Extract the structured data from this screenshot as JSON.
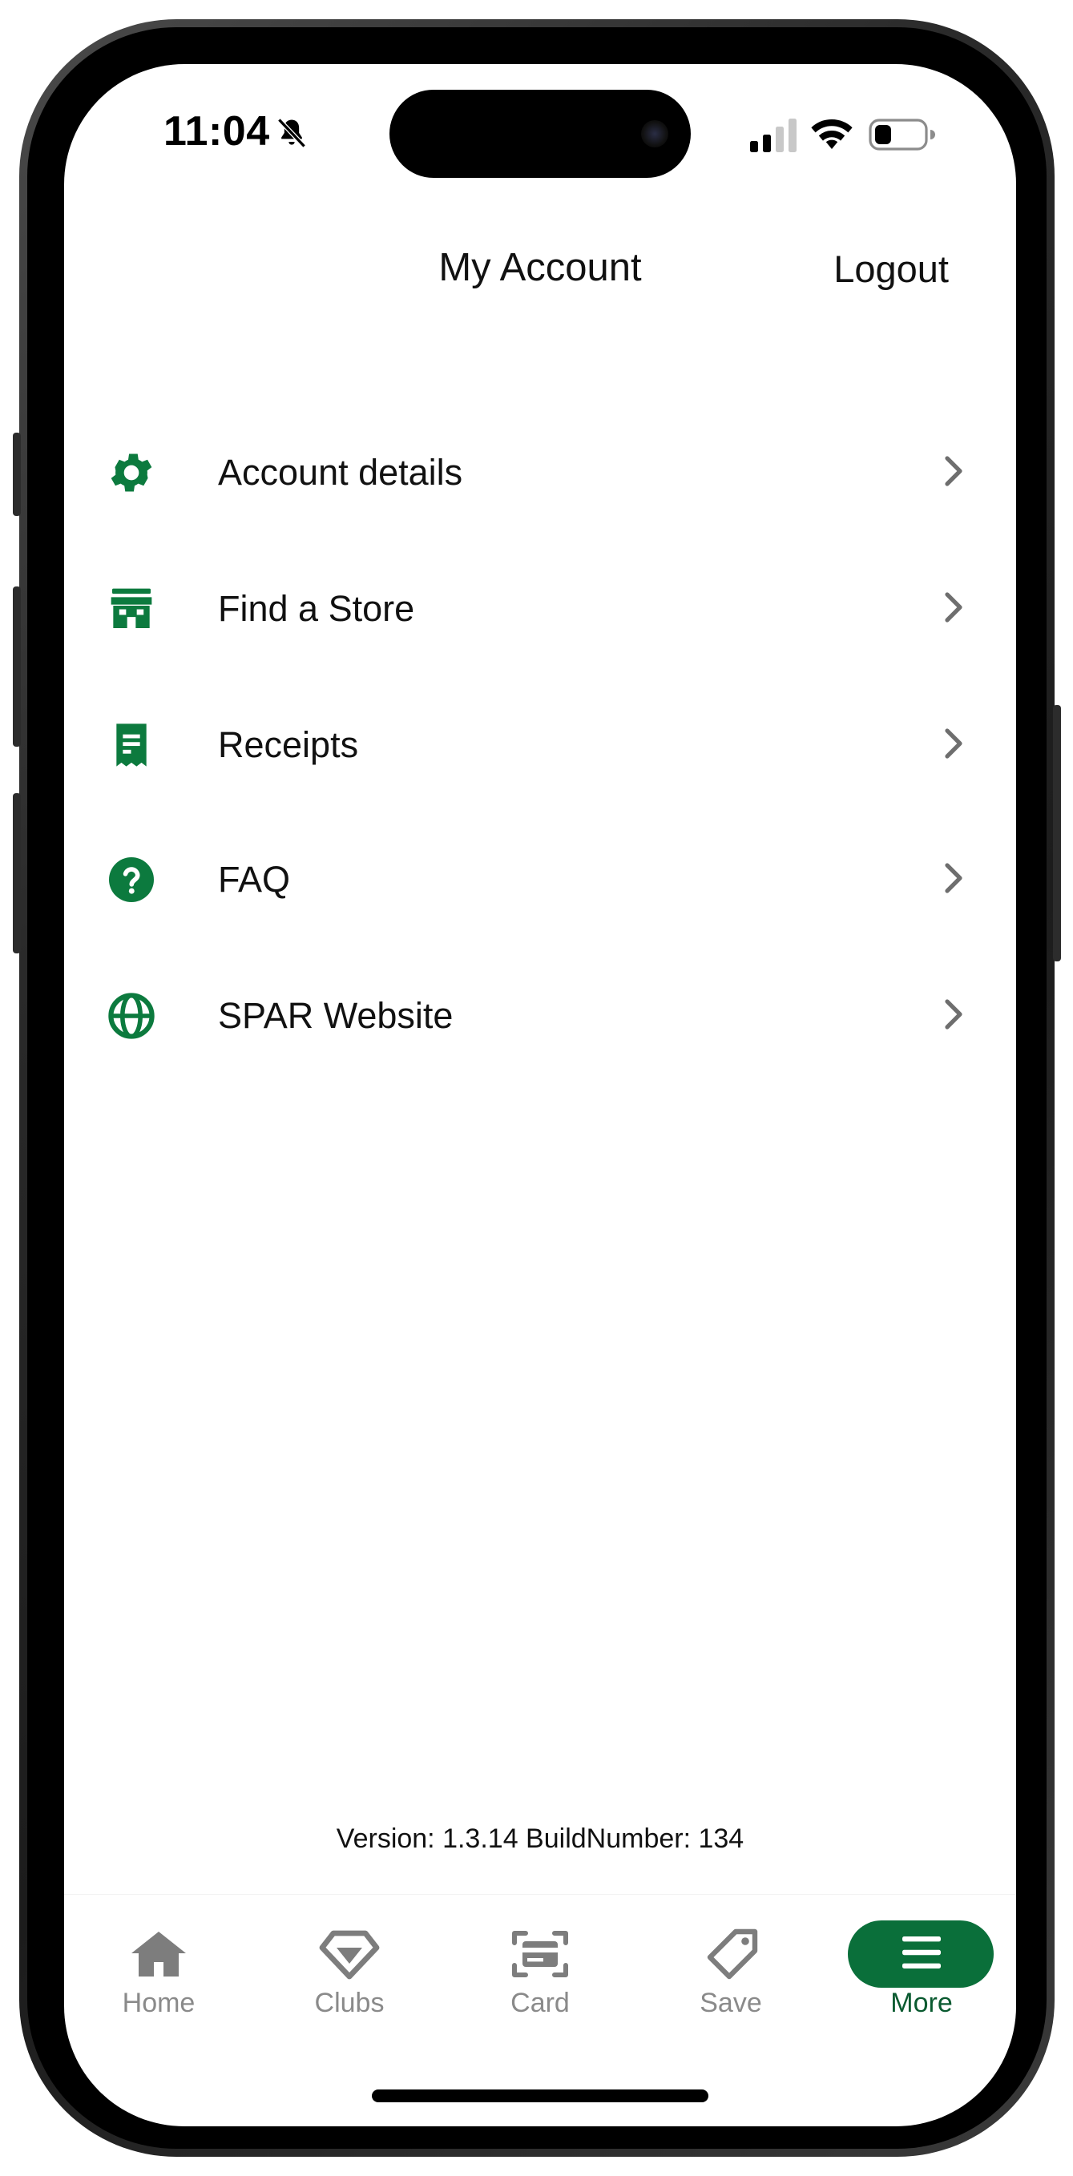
{
  "status_bar": {
    "time": "11:04",
    "icons": [
      "bell-slash-icon",
      "cellular-signal-icon",
      "wifi-icon",
      "battery-icon"
    ]
  },
  "header": {
    "title": "My Account",
    "logout_label": "Logout"
  },
  "menu": {
    "items": [
      {
        "label": "Account details",
        "icon": "gear-icon"
      },
      {
        "label": "Find a Store",
        "icon": "store-icon"
      },
      {
        "label": "Receipts",
        "icon": "receipt-icon"
      },
      {
        "label": "FAQ",
        "icon": "help-circle-icon"
      },
      {
        "label": "SPAR Website",
        "icon": "globe-icon"
      }
    ]
  },
  "footer": {
    "version_text": "Version: 1.3.14 BuildNumber: 134"
  },
  "tabbar": {
    "tabs": [
      {
        "label": "Home",
        "icon": "home-icon",
        "active": false
      },
      {
        "label": "Clubs",
        "icon": "diamond-icon",
        "active": false
      },
      {
        "label": "Card",
        "icon": "card-scan-icon",
        "active": false
      },
      {
        "label": "Save",
        "icon": "tag-icon",
        "active": false
      },
      {
        "label": "More",
        "icon": "menu-icon",
        "active": true
      }
    ]
  },
  "colors": {
    "brand_green": "#0a6f3a",
    "icon_green": "#0c7a3e",
    "inactive_gray": "#8a8a8a",
    "chevron_gray": "#6e6e6e"
  }
}
